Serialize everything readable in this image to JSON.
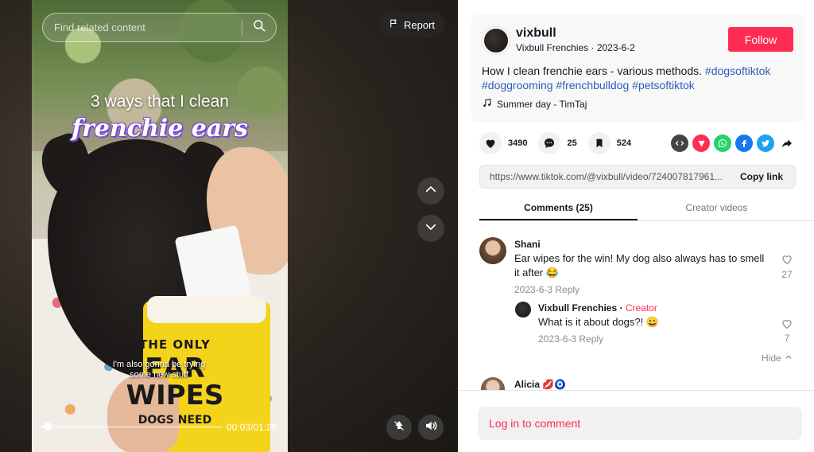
{
  "video": {
    "search_placeholder": "Find related content",
    "report_label": "Report",
    "caption_main": "3 ways that I clean",
    "caption_script": "frenchie ears",
    "subtitle": "I'm also gonna be trying some new stuff",
    "jar_line1": "THE ONLY",
    "jar_line2": "EAR",
    "jar_line3": "WIPES",
    "jar_line4": "DOGS NEED",
    "time": "00:03/01:26",
    "progress_fraction": 0.035
  },
  "author": {
    "username": "vixbull",
    "subline": "Vixbull Frenchies · 2023-6-2",
    "follow_label": "Follow"
  },
  "description": {
    "text": "How I clean frenchie ears - various methods.",
    "tags": [
      "#dogsoftiktok",
      "#doggrooming",
      "#frenchbulldog",
      "#petsoftiktok"
    ]
  },
  "music": "Summer day - TimTaj",
  "actions": {
    "likes": "3490",
    "comments": "25",
    "saves": "524"
  },
  "share_icons": [
    "embed-icon",
    "send-icon",
    "whatsapp-icon",
    "facebook-icon",
    "twitter-icon",
    "share-arrow-icon"
  ],
  "link": {
    "url": "https://www.tiktok.com/@vixbull/video/724007817961...",
    "copy_label": "Copy link"
  },
  "tabs": {
    "comments": "Comments (25)",
    "creator": "Creator videos"
  },
  "comments": [
    {
      "name": "Shani",
      "text": "Ear wipes for the win! My dog also always has to smell it after 😂",
      "date": "2023-6-3",
      "reply_label": "Reply",
      "likes": "27",
      "reply": {
        "name": "Vixbull Frenchies",
        "sep": " · ",
        "creator_label": "Creator",
        "text": "What is it about dogs?! 😀",
        "date": "2023-6-3",
        "reply_label": "Reply",
        "likes": "7"
      },
      "hide_label": "Hide"
    },
    {
      "name": "Alicia 💋🧿"
    }
  ],
  "login_label": "Log in to comment",
  "colors": {
    "accent": "#fe2c55",
    "tag_blue": "#2b5db9"
  }
}
